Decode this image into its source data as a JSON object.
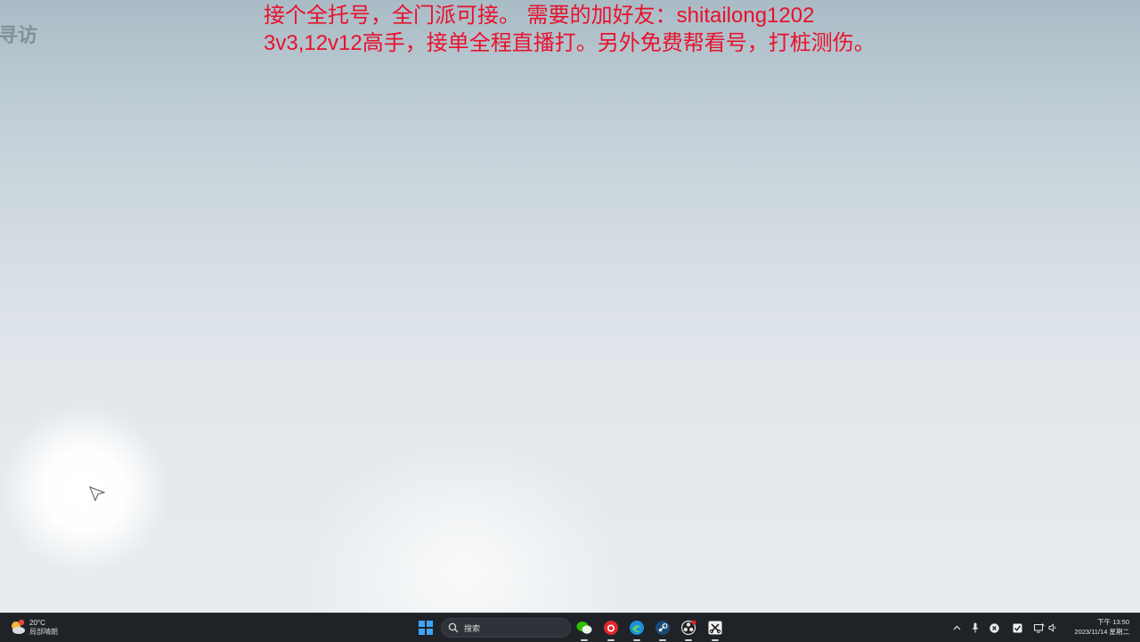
{
  "desktop": {
    "corner_text": "寻访",
    "overlay_lines": [
      [
        {
          "text": "接个全托号，全门派可接。 需要的加好友：",
          "latin": false
        },
        {
          "text": "shitailong1202",
          "latin": true
        }
      ],
      [
        {
          "text": "3v3,12v12",
          "latin": true
        },
        {
          "text": "高手，接单全程直播打。另外免费帮看号，打桩测伤。",
          "latin": false
        }
      ]
    ]
  },
  "taskbar": {
    "weather": {
      "temp": "20°C",
      "condition": "局部晴朗",
      "icon": "partly-sunny-icon"
    },
    "search": {
      "placeholder": "搜索"
    },
    "apps": [
      {
        "name": "wechat-icon",
        "active": true
      },
      {
        "name": "netease-music-icon",
        "active": true
      },
      {
        "name": "edge-browser-icon",
        "active": true
      },
      {
        "name": "steam-icon",
        "active": true
      },
      {
        "name": "obs-studio-icon",
        "active": true
      },
      {
        "name": "capture-tool-icon",
        "active": true
      }
    ],
    "clock": {
      "time": "下午 13:50",
      "date": "2023/11/14 星期二"
    },
    "colors": {
      "overlay_text": "#e8112d",
      "taskbar_bg": "#1f2328",
      "start_blue": "#3fa5f2"
    }
  }
}
